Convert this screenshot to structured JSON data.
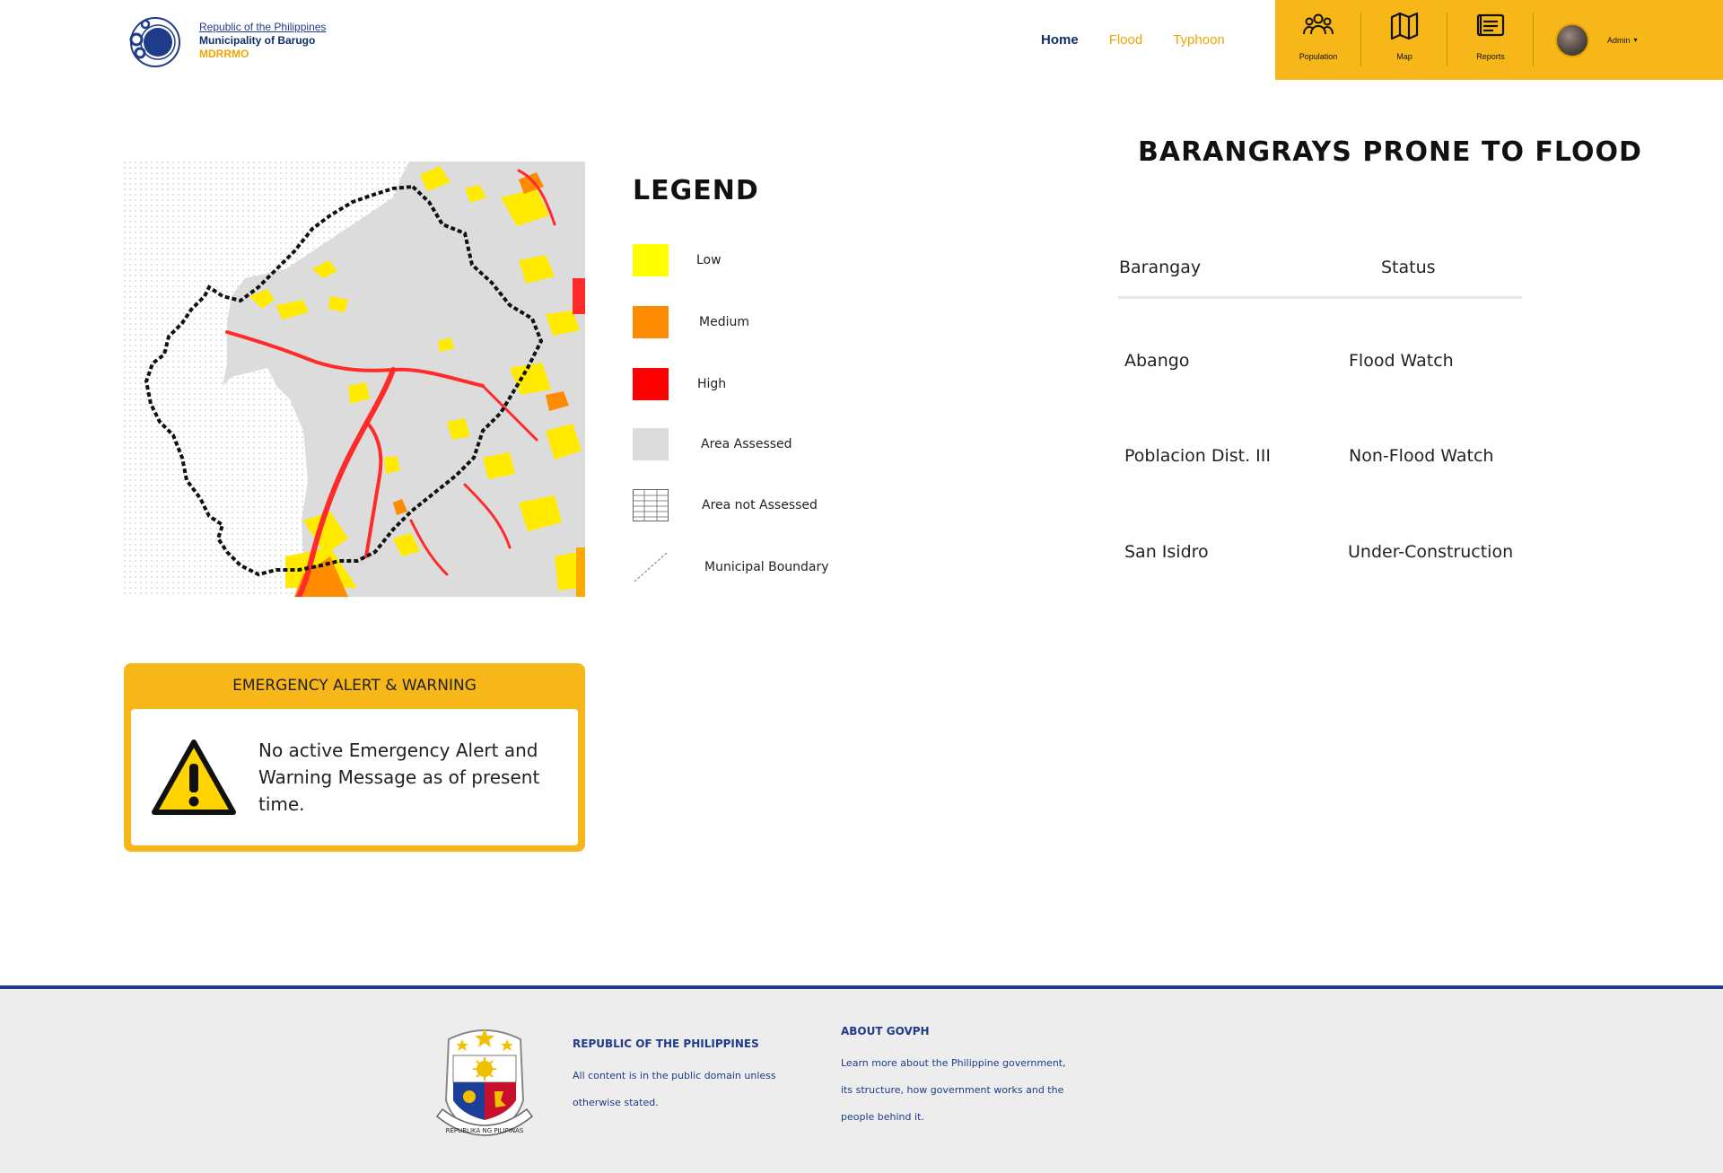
{
  "header": {
    "logo_line1": "Republic of the Philippines",
    "logo_line2": "Municipality of Barugo",
    "logo_line3": "MDRRMO",
    "nav": {
      "home": "Home",
      "flood": "Flood",
      "typhoon": "Typhoon"
    },
    "tools": {
      "population": "Population",
      "map": "Map",
      "reports": "Reports"
    },
    "user": "Admin",
    "toolbar_color": "#f7b718"
  },
  "legend": {
    "title": "LEGEND",
    "items": {
      "low": "Low",
      "medium": "Medium",
      "high": "High",
      "assessed": "Area Assessed",
      "not_assessed": "Area not Assessed",
      "boundary": "Municipal Boundary"
    },
    "colors": {
      "low": "#ffff00",
      "medium": "#ff8c00",
      "high": "#ff0000",
      "assessed": "#dcdcdc"
    }
  },
  "table": {
    "title": "BARANGRAYS PRONE TO FLOOD",
    "col_barangay": "Barangay",
    "col_status": "Status",
    "rows": [
      {
        "barangay": "Abango",
        "status": "Flood Watch"
      },
      {
        "barangay": "Poblacion Dist. III",
        "status": "Non-Flood Watch"
      },
      {
        "barangay": "San Isidro",
        "status": "Under-Construction"
      }
    ]
  },
  "alert": {
    "title": "EMERGENCY ALERT & WARNING",
    "message": "No active Emergency Alert and Warning Message as of present time."
  },
  "footer": {
    "col1_head": "REPUBLIC OF THE PHILIPPINES",
    "col1_line1": "All content is in the public domain unless",
    "col1_line2": "otherwise stated.",
    "col2_head": "ABOUT GOVPH",
    "col2_line1": "Learn more about the Philippine government,",
    "col2_line2": "its structure, how government works and the",
    "col2_line3": "people behind it.",
    "seal_text": "REPUBLIKA NG PILIPINAS"
  }
}
